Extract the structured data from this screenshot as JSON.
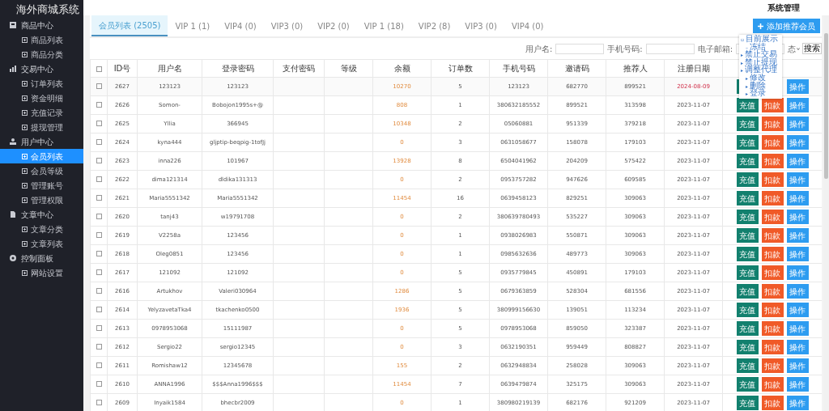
{
  "app_title": "海外商城系统",
  "header": {
    "title": "系统管理"
  },
  "sidebar": {
    "groups": [
      {
        "label": "商品中心",
        "items": [
          {
            "label": "商品列表",
            "selected": false
          },
          {
            "label": "商品分类",
            "selected": false
          }
        ]
      },
      {
        "label": "交易中心",
        "items": [
          {
            "label": "订单列表",
            "selected": false
          },
          {
            "label": "资金明细",
            "selected": false
          },
          {
            "label": "充值记录",
            "selected": false
          },
          {
            "label": "提现管理",
            "selected": false
          }
        ]
      },
      {
        "label": "用户中心",
        "items": [
          {
            "label": "会员列表",
            "selected": true
          },
          {
            "label": "会员等级",
            "selected": false
          },
          {
            "label": "管理账号",
            "selected": false
          },
          {
            "label": "管理权限",
            "selected": false
          }
        ]
      },
      {
        "label": "文章中心",
        "items": [
          {
            "label": "文章分类",
            "selected": false
          },
          {
            "label": "文章列表",
            "selected": false
          }
        ]
      },
      {
        "label": "控制面板",
        "items": [
          {
            "label": "网站设置",
            "selected": false
          }
        ]
      }
    ]
  },
  "tabs": [
    {
      "label": "会员列表 (2505)",
      "selected": true
    },
    {
      "label": "VIP 1 (1)",
      "selected": false
    },
    {
      "label": "VIP4 (0)",
      "selected": false
    },
    {
      "label": "VIP3 (0)",
      "selected": false
    },
    {
      "label": "VIP2 (0)",
      "selected": false
    },
    {
      "label": "VIP 1 (18)",
      "selected": false
    },
    {
      "label": "VIP2 (8)",
      "selected": false
    },
    {
      "label": "VIP3 (0)",
      "selected": false
    },
    {
      "label": "VIP4 (0)",
      "selected": false
    }
  ],
  "add_button": {
    "label": "添加推荐会员"
  },
  "filters": [
    {
      "label": "用户名:"
    },
    {
      "label": "手机号码:"
    },
    {
      "label": "电子邮箱:"
    }
  ],
  "status_select": {
    "value": "态"
  },
  "search_button": {
    "label": "搜索"
  },
  "table": {
    "all_checked": false,
    "columns": [
      "ID号",
      "用户名",
      "登录密码",
      "支付密码",
      "等级",
      "余额",
      "订单数",
      "手机号码",
      "邀请码",
      "推荐人",
      "注册日期"
    ],
    "rows": [
      {
        "checked": false,
        "id": "2627",
        "username": "123123",
        "password": "123123",
        "balance": "10270",
        "orders": "5",
        "phone": "123123",
        "invite": "682770",
        "referrer": "899521",
        "date": "2024-08-09",
        "recent": true,
        "actions": [
          {
            "kind": "recharge"
          },
          {
            "kind": "operate",
            "label": "操作"
          }
        ]
      },
      {
        "checked": false,
        "id": "2626",
        "username": "Somon-",
        "password": "Bobojon1995s+@",
        "balance": "808",
        "orders": "1",
        "phone": "380632185552",
        "invite": "899521",
        "referrer": "313598",
        "date": "2023-11-07",
        "recent": false,
        "actions": [
          {
            "kind": "recharge",
            "label": "充值"
          },
          {
            "kind": "deduct",
            "label": "扣款"
          },
          {
            "kind": "operate",
            "label": "操作"
          }
        ]
      },
      {
        "checked": false,
        "id": "2625",
        "username": "Yllia",
        "password": "366945",
        "balance": "10348",
        "orders": "2",
        "phone": "05060881",
        "invite": "951339",
        "referrer": "379218",
        "date": "2023-11-07",
        "recent": false,
        "actions": [
          {
            "kind": "recharge",
            "label": "充值"
          },
          {
            "kind": "deduct",
            "label": "扣款"
          },
          {
            "kind": "operate",
            "label": "操作"
          }
        ]
      },
      {
        "checked": false,
        "id": "2624",
        "username": "kyna444",
        "password": "gljptip-beqpig-1tofJj",
        "balance": "0",
        "orders": "3",
        "phone": "0631058677",
        "invite": "158078",
        "referrer": "179103",
        "date": "2023-11-07",
        "recent": false,
        "actions": [
          {
            "kind": "recharge",
            "label": "充值"
          },
          {
            "kind": "deduct",
            "label": "扣款"
          },
          {
            "kind": "operate",
            "label": "操作"
          }
        ]
      },
      {
        "checked": false,
        "id": "2623",
        "username": "inna226",
        "password": "101967",
        "balance": "13928",
        "orders": "8",
        "phone": "6504041962",
        "invite": "204209",
        "referrer": "575422",
        "date": "2023-11-07",
        "recent": false,
        "actions": [
          {
            "kind": "recharge",
            "label": "充值"
          },
          {
            "kind": "deduct",
            "label": "扣款"
          },
          {
            "kind": "operate",
            "label": "操作"
          }
        ]
      },
      {
        "checked": false,
        "id": "2622",
        "username": "dima121314",
        "password": "dldika131313",
        "balance": "0",
        "orders": "2",
        "phone": "0953757282",
        "invite": "947626",
        "referrer": "609585",
        "date": "2023-11-07",
        "recent": false,
        "actions": [
          {
            "kind": "recharge",
            "label": "充值"
          },
          {
            "kind": "deduct",
            "label": "扣款"
          },
          {
            "kind": "operate",
            "label": "操作"
          }
        ]
      },
      {
        "checked": false,
        "id": "2621",
        "username": "Maria5551342",
        "password": "Maria5551342",
        "balance": "11454",
        "orders": "16",
        "phone": "0639458123",
        "invite": "829251",
        "referrer": "309063",
        "date": "2023-11-07",
        "recent": false,
        "actions": [
          {
            "kind": "recharge",
            "label": "充值"
          },
          {
            "kind": "deduct",
            "label": "扣款"
          },
          {
            "kind": "operate",
            "label": "操作"
          }
        ]
      },
      {
        "checked": false,
        "id": "2620",
        "username": "tanj43",
        "password": "w19791708",
        "balance": "0",
        "orders": "2",
        "phone": "380639780493",
        "invite": "535227",
        "referrer": "309063",
        "date": "2023-11-07",
        "recent": false,
        "actions": [
          {
            "kind": "recharge",
            "label": "充值"
          },
          {
            "kind": "deduct",
            "label": "扣款"
          },
          {
            "kind": "operate",
            "label": "操作"
          }
        ]
      },
      {
        "checked": false,
        "id": "2619",
        "username": "V2258a",
        "password": "123456",
        "balance": "0",
        "orders": "1",
        "phone": "0938026983",
        "invite": "550871",
        "referrer": "309063",
        "date": "2023-11-07",
        "recent": false,
        "actions": [
          {
            "kind": "recharge",
            "label": "充值"
          },
          {
            "kind": "deduct",
            "label": "扣款"
          },
          {
            "kind": "operate",
            "label": "操作"
          }
        ]
      },
      {
        "checked": false,
        "id": "2618",
        "username": "Oleg0851",
        "password": "123456",
        "balance": "0",
        "orders": "1",
        "phone": "0985632636",
        "invite": "489773",
        "referrer": "309063",
        "date": "2023-11-07",
        "recent": false,
        "actions": [
          {
            "kind": "recharge",
            "label": "充值"
          },
          {
            "kind": "deduct",
            "label": "扣款"
          },
          {
            "kind": "operate",
            "label": "操作"
          }
        ]
      },
      {
        "checked": false,
        "id": "2617",
        "username": "121092",
        "password": "121092",
        "balance": "0",
        "orders": "5",
        "phone": "0935779845",
        "invite": "450891",
        "referrer": "179103",
        "date": "2023-11-07",
        "recent": false,
        "actions": [
          {
            "kind": "recharge",
            "label": "充值"
          },
          {
            "kind": "deduct",
            "label": "扣款"
          },
          {
            "kind": "operate",
            "label": "操作"
          }
        ]
      },
      {
        "checked": false,
        "id": "2616",
        "username": "Artukhov",
        "password": "Valeri030964",
        "balance": "1286",
        "orders": "5",
        "phone": "0679363859",
        "invite": "528304",
        "referrer": "681556",
        "date": "2023-11-07",
        "recent": false,
        "actions": [
          {
            "kind": "recharge",
            "label": "充值"
          },
          {
            "kind": "deduct",
            "label": "扣款"
          },
          {
            "kind": "operate",
            "label": "操作"
          }
        ]
      },
      {
        "checked": false,
        "id": "2614",
        "username": "YelyzavetaTka4",
        "password": "tkachenko0500",
        "balance": "1936",
        "orders": "5",
        "phone": "380999156630",
        "invite": "139051",
        "referrer": "113234",
        "date": "2023-11-07",
        "recent": false,
        "actions": [
          {
            "kind": "recharge",
            "label": "充值"
          },
          {
            "kind": "deduct",
            "label": "扣款"
          },
          {
            "kind": "operate",
            "label": "操作"
          }
        ]
      },
      {
        "checked": false,
        "id": "2613",
        "username": "0978953068",
        "password": "15111987",
        "balance": "0",
        "orders": "5",
        "phone": "0978953068",
        "invite": "859050",
        "referrer": "323387",
        "date": "2023-11-07",
        "recent": false,
        "actions": [
          {
            "kind": "recharge",
            "label": "充值"
          },
          {
            "kind": "deduct",
            "label": "扣款"
          },
          {
            "kind": "operate",
            "label": "操作"
          }
        ]
      },
      {
        "checked": false,
        "id": "2612",
        "username": "Sergio22",
        "password": "sergio12345",
        "balance": "0",
        "orders": "3",
        "phone": "0632190351",
        "invite": "959449",
        "referrer": "808827",
        "date": "2023-11-07",
        "recent": false,
        "actions": [
          {
            "kind": "recharge",
            "label": "充值"
          },
          {
            "kind": "deduct",
            "label": "扣款"
          },
          {
            "kind": "operate",
            "label": "操作"
          }
        ]
      },
      {
        "checked": false,
        "id": "2611",
        "username": "Romishaw12",
        "password": "12345678",
        "balance": "155",
        "orders": "2",
        "phone": "0632948834",
        "invite": "258028",
        "referrer": "309063",
        "date": "2023-11-07",
        "recent": false,
        "actions": [
          {
            "kind": "recharge",
            "label": "充值"
          },
          {
            "kind": "deduct",
            "label": "扣款"
          },
          {
            "kind": "operate",
            "label": "操作"
          }
        ]
      },
      {
        "checked": false,
        "id": "2610",
        "username": "ANNA1996",
        "password": "$$$Anna1996$$$",
        "balance": "11454",
        "orders": "7",
        "phone": "0639479874",
        "invite": "325175",
        "referrer": "309063",
        "date": "2023-11-07",
        "recent": false,
        "actions": [
          {
            "kind": "recharge",
            "label": "充值"
          },
          {
            "kind": "deduct",
            "label": "扣款"
          },
          {
            "kind": "operate",
            "label": "操作"
          }
        ]
      },
      {
        "checked": false,
        "id": "2609",
        "username": "Inyaik1584",
        "password": "bhecbr2009",
        "balance": "0",
        "orders": "1",
        "phone": "380980219139",
        "invite": "682176",
        "referrer": "921209",
        "date": "2023-11-07",
        "recent": false,
        "actions": [
          {
            "kind": "recharge",
            "label": "充值"
          },
          {
            "kind": "deduct",
            "label": "扣款"
          },
          {
            "kind": "operate",
            "label": "操作"
          }
        ]
      }
    ]
  },
  "popover_menu": [
    {
      "marker": "▫",
      "label": "目前展示",
      "children": [
        {
          "marker": "–",
          "label": "冻结"
        }
      ]
    },
    {
      "marker": "▸",
      "label": "禁止交易"
    },
    {
      "marker": "▸",
      "label": "禁止提现"
    },
    {
      "marker": "▸",
      "label": "调整代理",
      "children": [
        {
          "marker": "▸",
          "label": "修改"
        },
        {
          "marker": "▸",
          "label": "删除"
        },
        {
          "marker": "▸",
          "label": "登录"
        }
      ]
    }
  ]
}
